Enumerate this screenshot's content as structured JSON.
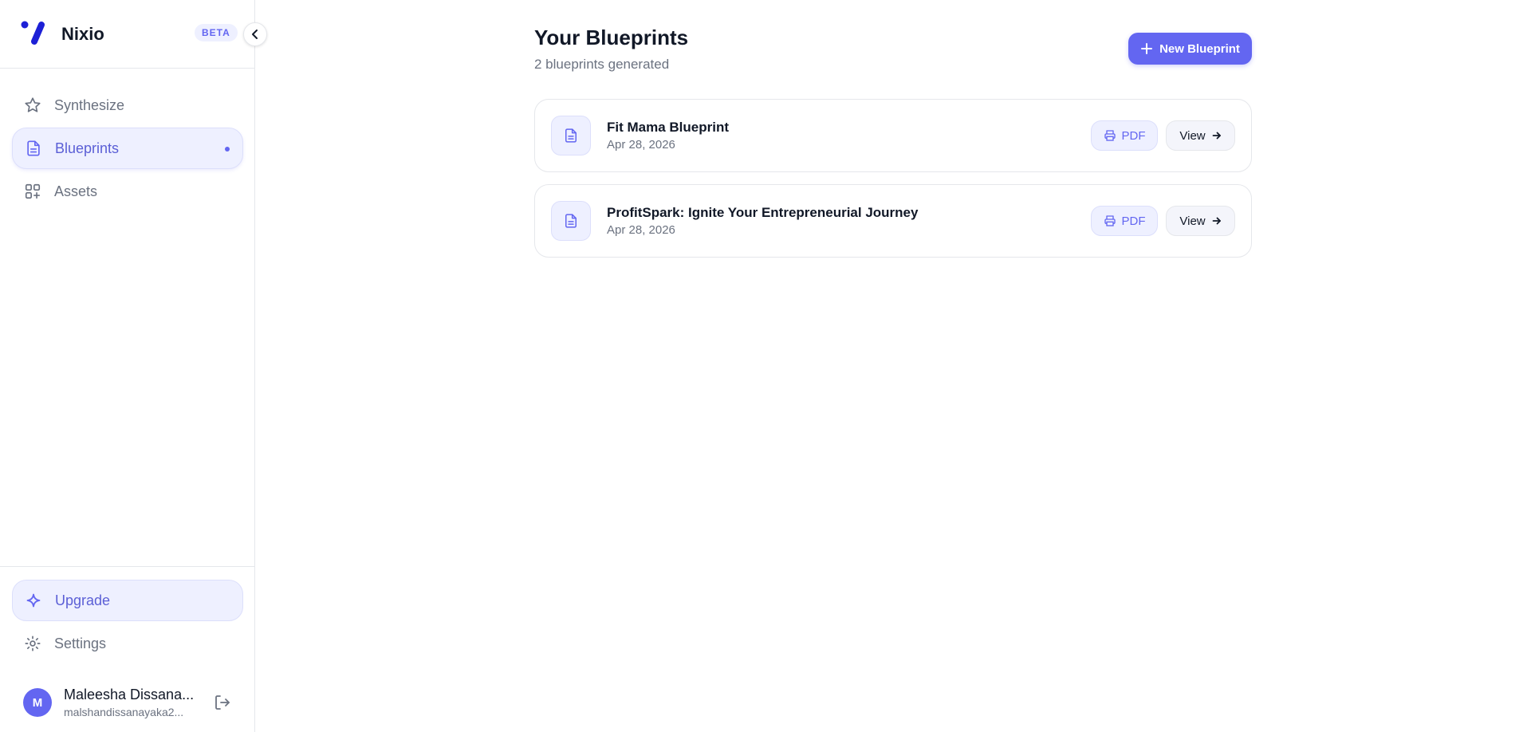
{
  "brand": {
    "name": "Nixio",
    "badge": "BETA"
  },
  "sidebar": {
    "items": [
      {
        "label": "Synthesize",
        "icon": "star-icon"
      },
      {
        "label": "Blueprints",
        "icon": "document-icon",
        "active": true
      },
      {
        "label": "Assets",
        "icon": "grid-plus-icon"
      }
    ],
    "upgrade_label": "Upgrade",
    "settings_label": "Settings",
    "user": {
      "initial": "M",
      "name": "Maleesha Dissana...",
      "email": "malshandissanayaka2..."
    }
  },
  "main": {
    "title": "Your Blueprints",
    "subtitle": "2 blueprints generated",
    "new_button_label": "New Blueprint",
    "blueprints": [
      {
        "title": "Fit Mama Blueprint",
        "date": "Apr 28, 2026",
        "pdf_label": "PDF",
        "view_label": "View"
      },
      {
        "title": "ProfitSpark: Ignite Your Entrepreneurial Journey",
        "date": "Apr 28, 2026",
        "pdf_label": "PDF",
        "view_label": "View"
      }
    ]
  },
  "colors": {
    "accent": "#6366f1",
    "accent_soft": "#eef0ff",
    "text_primary": "#111827",
    "text_muted": "#6b7280",
    "border": "#e5e7eb"
  }
}
